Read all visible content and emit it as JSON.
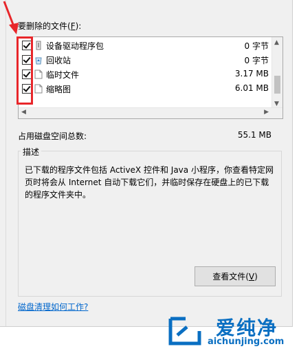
{
  "files_label": "要删除的文件(",
  "files_label_hotkey": "F",
  "files_label_end": "):",
  "items": [
    {
      "name": "设备驱动程序包",
      "size": "0 字节",
      "checked": true,
      "icon": "driver-package-icon"
    },
    {
      "name": "回收站",
      "size": "0 字节",
      "checked": true,
      "icon": "recycle-bin-icon"
    },
    {
      "name": "临时文件",
      "size": "3.17 MB",
      "checked": true,
      "icon": "file-icon"
    },
    {
      "name": "缩略图",
      "size": "6.01 MB",
      "checked": true,
      "icon": "file-icon"
    }
  ],
  "total_label": "占用磁盘空间总数:",
  "total_value": "55.1 MB",
  "description_title": "描述",
  "description_text": "已下载的程序文件包括 ActiveX 控件和 Java 小程序，你查看特定网页时将会从 Internet 自动下载它们，并临时保存在硬盘上的已下载的程序文件夹中。",
  "view_files_button": "查看文件(",
  "view_files_hotkey": "V",
  "view_files_end": ")",
  "help_link": "磁盘清理如何工作?",
  "watermark_title": "爱纯净",
  "watermark_url": "aichunjing.com",
  "colors": {
    "highlight": "#e8262a",
    "link": "#0066cc",
    "watermark": "#0a6fc2"
  }
}
